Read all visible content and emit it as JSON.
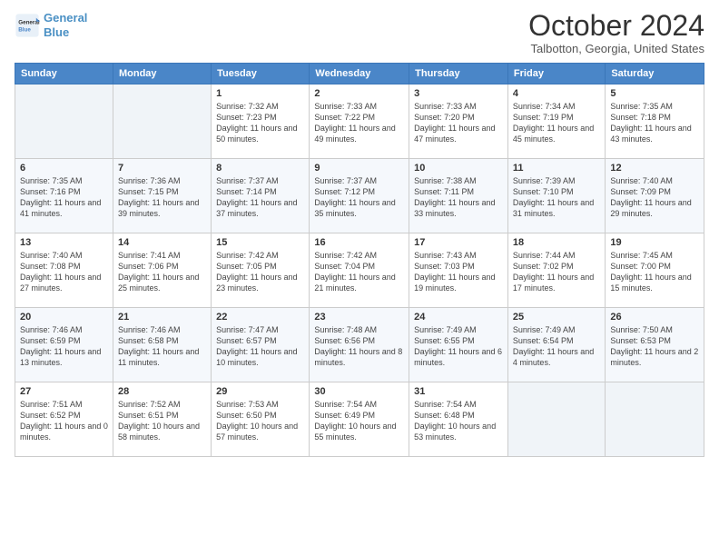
{
  "logo": {
    "line1": "General",
    "line2": "Blue"
  },
  "title": "October 2024",
  "location": "Talbotton, Georgia, United States",
  "days_header": [
    "Sunday",
    "Monday",
    "Tuesday",
    "Wednesday",
    "Thursday",
    "Friday",
    "Saturday"
  ],
  "weeks": [
    [
      {
        "day": "",
        "info": ""
      },
      {
        "day": "",
        "info": ""
      },
      {
        "day": "1",
        "info": "Sunrise: 7:32 AM\nSunset: 7:23 PM\nDaylight: 11 hours and 50 minutes."
      },
      {
        "day": "2",
        "info": "Sunrise: 7:33 AM\nSunset: 7:22 PM\nDaylight: 11 hours and 49 minutes."
      },
      {
        "day": "3",
        "info": "Sunrise: 7:33 AM\nSunset: 7:20 PM\nDaylight: 11 hours and 47 minutes."
      },
      {
        "day": "4",
        "info": "Sunrise: 7:34 AM\nSunset: 7:19 PM\nDaylight: 11 hours and 45 minutes."
      },
      {
        "day": "5",
        "info": "Sunrise: 7:35 AM\nSunset: 7:18 PM\nDaylight: 11 hours and 43 minutes."
      }
    ],
    [
      {
        "day": "6",
        "info": "Sunrise: 7:35 AM\nSunset: 7:16 PM\nDaylight: 11 hours and 41 minutes."
      },
      {
        "day": "7",
        "info": "Sunrise: 7:36 AM\nSunset: 7:15 PM\nDaylight: 11 hours and 39 minutes."
      },
      {
        "day": "8",
        "info": "Sunrise: 7:37 AM\nSunset: 7:14 PM\nDaylight: 11 hours and 37 minutes."
      },
      {
        "day": "9",
        "info": "Sunrise: 7:37 AM\nSunset: 7:12 PM\nDaylight: 11 hours and 35 minutes."
      },
      {
        "day": "10",
        "info": "Sunrise: 7:38 AM\nSunset: 7:11 PM\nDaylight: 11 hours and 33 minutes."
      },
      {
        "day": "11",
        "info": "Sunrise: 7:39 AM\nSunset: 7:10 PM\nDaylight: 11 hours and 31 minutes."
      },
      {
        "day": "12",
        "info": "Sunrise: 7:40 AM\nSunset: 7:09 PM\nDaylight: 11 hours and 29 minutes."
      }
    ],
    [
      {
        "day": "13",
        "info": "Sunrise: 7:40 AM\nSunset: 7:08 PM\nDaylight: 11 hours and 27 minutes."
      },
      {
        "day": "14",
        "info": "Sunrise: 7:41 AM\nSunset: 7:06 PM\nDaylight: 11 hours and 25 minutes."
      },
      {
        "day": "15",
        "info": "Sunrise: 7:42 AM\nSunset: 7:05 PM\nDaylight: 11 hours and 23 minutes."
      },
      {
        "day": "16",
        "info": "Sunrise: 7:42 AM\nSunset: 7:04 PM\nDaylight: 11 hours and 21 minutes."
      },
      {
        "day": "17",
        "info": "Sunrise: 7:43 AM\nSunset: 7:03 PM\nDaylight: 11 hours and 19 minutes."
      },
      {
        "day": "18",
        "info": "Sunrise: 7:44 AM\nSunset: 7:02 PM\nDaylight: 11 hours and 17 minutes."
      },
      {
        "day": "19",
        "info": "Sunrise: 7:45 AM\nSunset: 7:00 PM\nDaylight: 11 hours and 15 minutes."
      }
    ],
    [
      {
        "day": "20",
        "info": "Sunrise: 7:46 AM\nSunset: 6:59 PM\nDaylight: 11 hours and 13 minutes."
      },
      {
        "day": "21",
        "info": "Sunrise: 7:46 AM\nSunset: 6:58 PM\nDaylight: 11 hours and 11 minutes."
      },
      {
        "day": "22",
        "info": "Sunrise: 7:47 AM\nSunset: 6:57 PM\nDaylight: 11 hours and 10 minutes."
      },
      {
        "day": "23",
        "info": "Sunrise: 7:48 AM\nSunset: 6:56 PM\nDaylight: 11 hours and 8 minutes."
      },
      {
        "day": "24",
        "info": "Sunrise: 7:49 AM\nSunset: 6:55 PM\nDaylight: 11 hours and 6 minutes."
      },
      {
        "day": "25",
        "info": "Sunrise: 7:49 AM\nSunset: 6:54 PM\nDaylight: 11 hours and 4 minutes."
      },
      {
        "day": "26",
        "info": "Sunrise: 7:50 AM\nSunset: 6:53 PM\nDaylight: 11 hours and 2 minutes."
      }
    ],
    [
      {
        "day": "27",
        "info": "Sunrise: 7:51 AM\nSunset: 6:52 PM\nDaylight: 11 hours and 0 minutes."
      },
      {
        "day": "28",
        "info": "Sunrise: 7:52 AM\nSunset: 6:51 PM\nDaylight: 10 hours and 58 minutes."
      },
      {
        "day": "29",
        "info": "Sunrise: 7:53 AM\nSunset: 6:50 PM\nDaylight: 10 hours and 57 minutes."
      },
      {
        "day": "30",
        "info": "Sunrise: 7:54 AM\nSunset: 6:49 PM\nDaylight: 10 hours and 55 minutes."
      },
      {
        "day": "31",
        "info": "Sunrise: 7:54 AM\nSunset: 6:48 PM\nDaylight: 10 hours and 53 minutes."
      },
      {
        "day": "",
        "info": ""
      },
      {
        "day": "",
        "info": ""
      }
    ]
  ]
}
